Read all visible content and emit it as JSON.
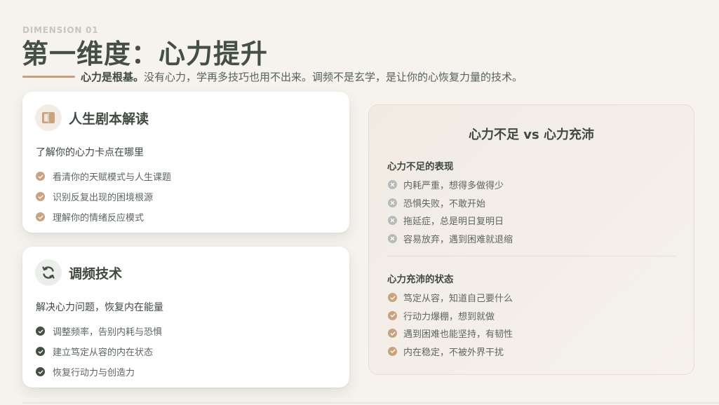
{
  "header": {
    "eyebrow": "DIMENSION 01",
    "title": "第一维度：心力提升",
    "subtitle_strong": "心力是根基。",
    "subtitle_rest": "没有心力，学再多技巧也用不出来。调频不是玄学，是让你的心恢复力量的技术。"
  },
  "cards": [
    {
      "icon": "book-icon",
      "title": "人生剧本解读",
      "lead": "了解你的心力卡点在哪里",
      "items": [
        "看清你的天赋模式与人生课题",
        "识别反复出现的困境根源",
        "理解你的情绪反应模式"
      ]
    },
    {
      "icon": "refresh-icon",
      "title": "调频技术",
      "lead": "解决心力问题，恢复内在能量",
      "items": [
        "调整频率，告别内耗与恐惧",
        "建立笃定从容的内在状态",
        "恢复行动力与创造力"
      ]
    }
  ],
  "compare": {
    "title": "心力不足 vs 心力充沛",
    "lack": {
      "title": "心力不足的表现",
      "items": [
        "内耗严重，想得多做得少",
        "恐惧失败，不敢开始",
        "拖延症，总是明日复明日",
        "容易放弃，遇到困难就退缩"
      ]
    },
    "full": {
      "title": "心力充沛的状态",
      "items": [
        "笃定从容，知道自己要什么",
        "行动力爆棚，想到就做",
        "遇到困难也能坚持，有韧性",
        "内在稳定，不被外界干扰"
      ]
    }
  },
  "colors": {
    "background": "#f6f3ee",
    "accent_warm": "#c9a37e",
    "accent_dark": "#435044",
    "muted_x": "#b5bbb6"
  }
}
